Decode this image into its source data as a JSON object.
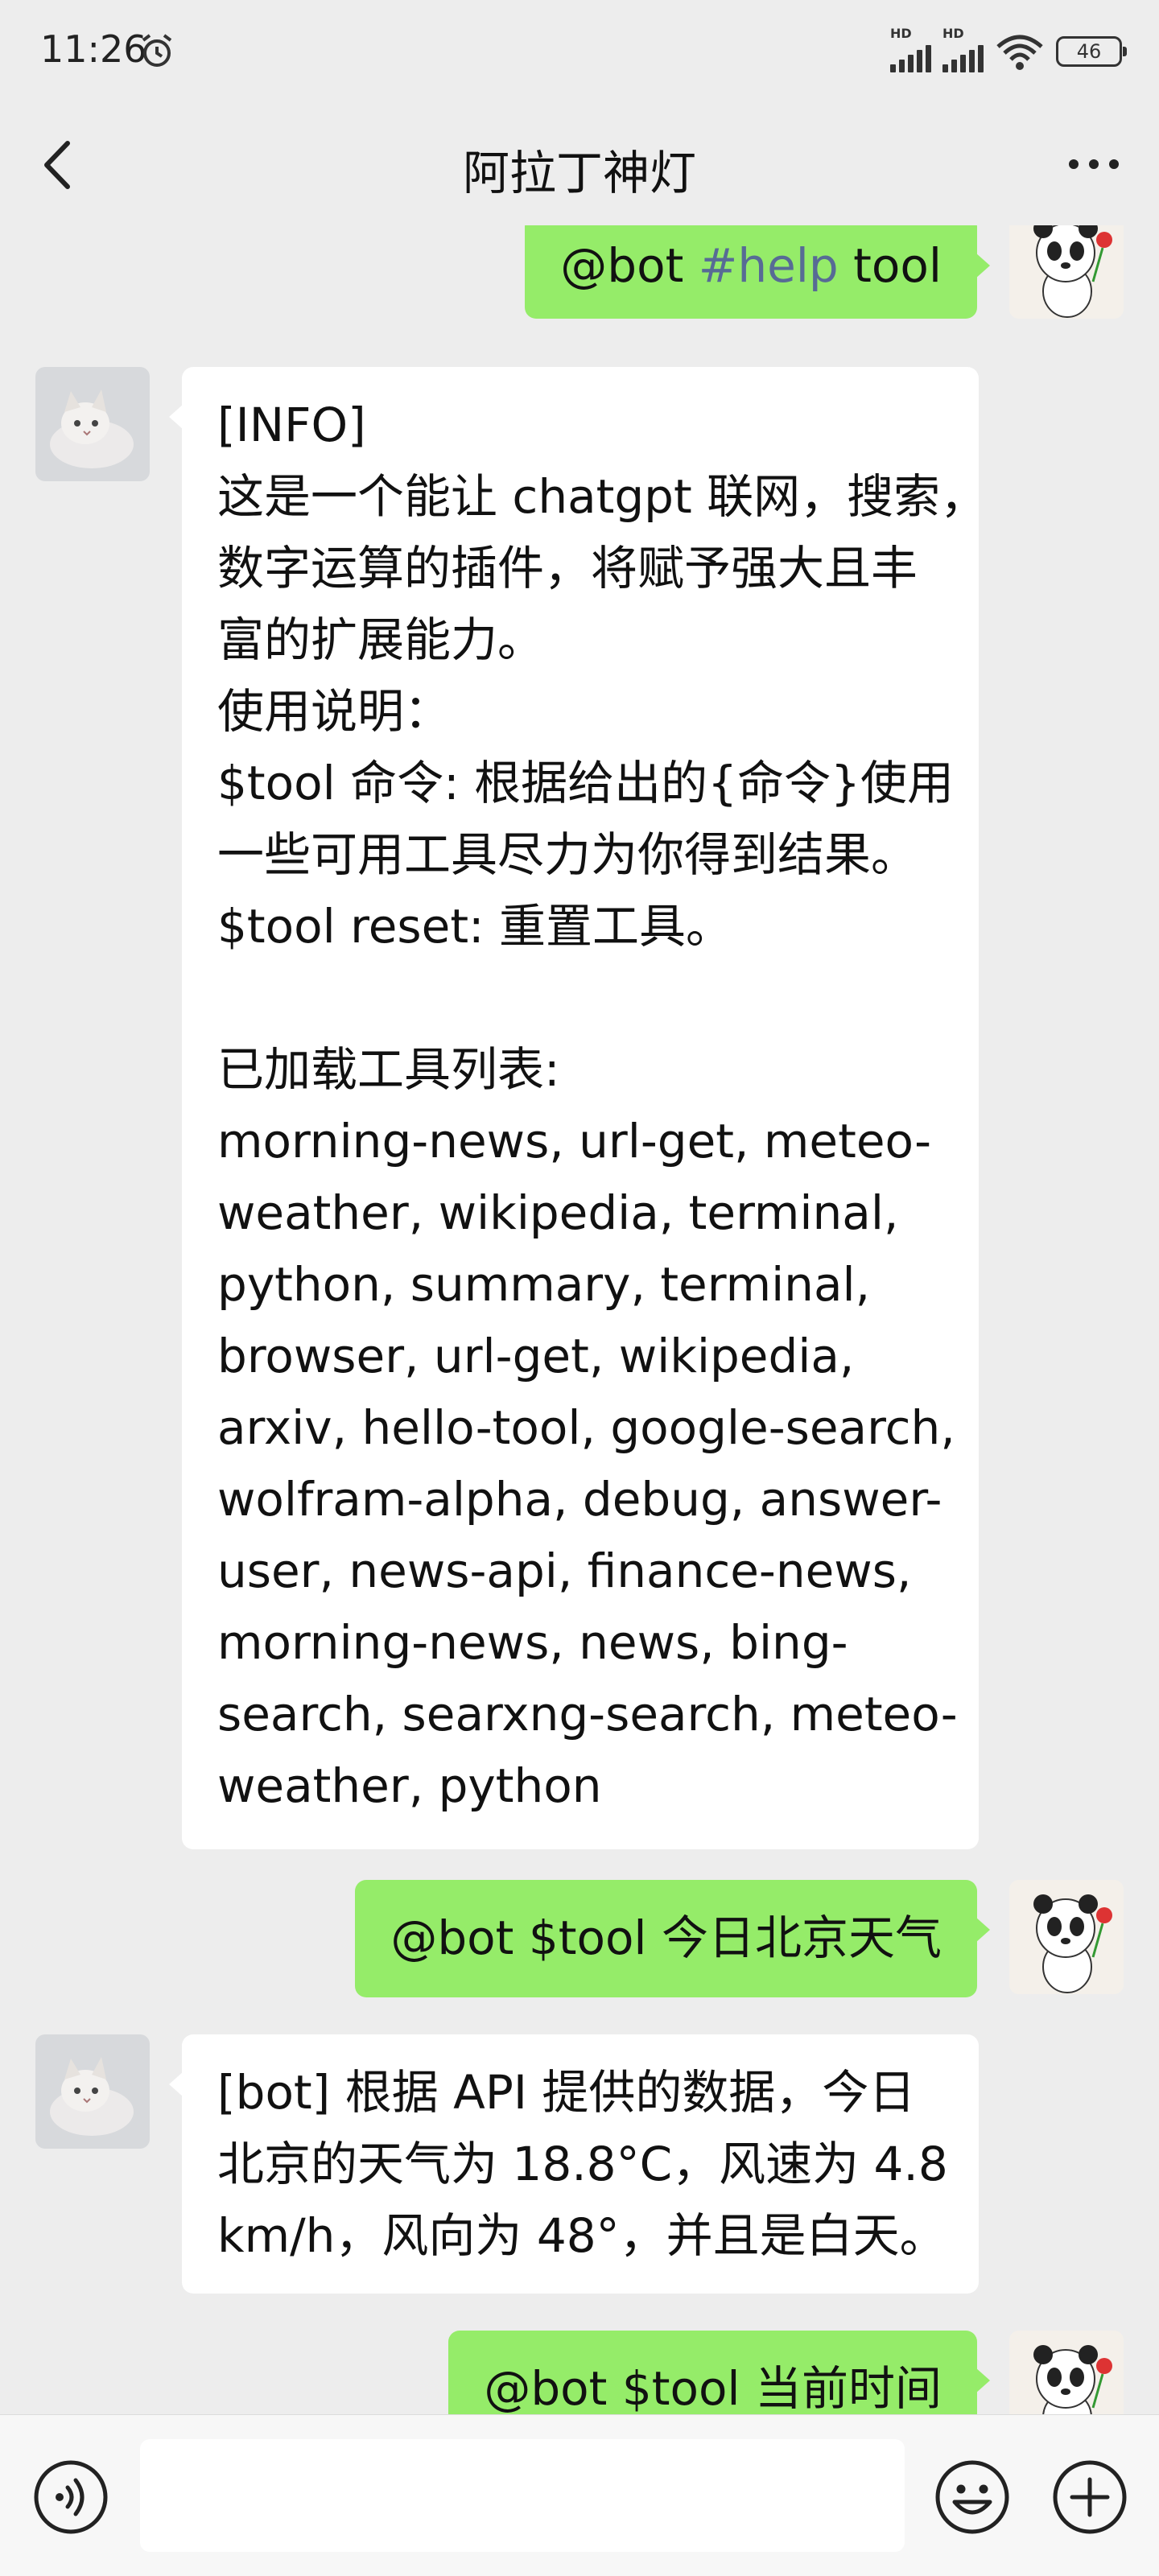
{
  "status_bar": {
    "time": "11:26",
    "battery": "46",
    "signal_label": "HD"
  },
  "header": {
    "title": "阿拉丁神灯"
  },
  "messages": [
    {
      "side": "out",
      "mention": "@bot",
      "hashtag": "#help",
      "rest": "tool"
    },
    {
      "side": "in",
      "lines": [
        "[INFO]",
        "这是一个能让 chatgpt 联网，搜索，",
        "数字运算的插件，将赋予强大且丰",
        "富的扩展能力。",
        "使用说明：",
        "$tool 命令: 根据给出的{命令}使用",
        "一些可用工具尽力为你得到结果。",
        "$tool reset: 重置工具。",
        "",
        "已加载工具列表:",
        "morning-news, url-get, meteo-",
        "weather, wikipedia, terminal,",
        "python, summary, terminal,",
        "browser, url-get, wikipedia,",
        "arxiv, hello-tool, google-search,",
        "wolfram-alpha, debug, answer-",
        "user, news-api, finance-news,",
        "morning-news, news, bing-",
        "search, searxng-search, meteo-",
        "weather, python"
      ]
    },
    {
      "side": "out",
      "text": "@bot $tool 今日北京天气"
    },
    {
      "side": "in",
      "lines": [
        "[bot] 根据 API 提供的数据，今日",
        "北京的天气为 18.8°C，风速为 4.8",
        "km/h，风向为 48°，并且是白天。"
      ]
    },
    {
      "side": "out",
      "text": "@bot $tool 当前时间"
    }
  ],
  "icons": {
    "back": "back-arrow-icon",
    "more": "more-dots-icon",
    "voice": "voice-icon",
    "emoji": "emoji-icon",
    "plus": "plus-icon"
  },
  "colors": {
    "background": "#ededed",
    "outgoing_bubble": "#95ec69",
    "incoming_bubble": "#ffffff",
    "hashtag": "#576b95"
  }
}
